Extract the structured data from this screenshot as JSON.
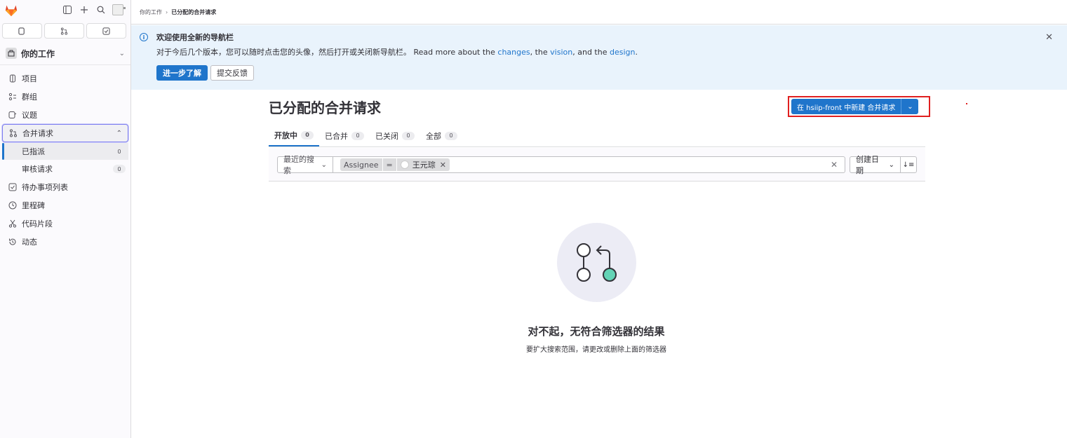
{
  "sidebar": {
    "section_title": "你的工作",
    "nav": [
      {
        "label": "项目",
        "icon": "project-icon"
      },
      {
        "label": "群组",
        "icon": "group-icon"
      },
      {
        "label": "议题",
        "icon": "issues-icon"
      },
      {
        "label": "合并请求",
        "icon": "merge-request-icon"
      }
    ],
    "sub_items": [
      {
        "label": "已指派",
        "count": "0"
      },
      {
        "label": "审核请求",
        "count": "0"
      }
    ],
    "nav2": [
      {
        "label": "待办事项列表",
        "icon": "todo-icon"
      },
      {
        "label": "里程碑",
        "icon": "milestone-icon"
      },
      {
        "label": "代码片段",
        "icon": "snippet-icon"
      },
      {
        "label": "动态",
        "icon": "activity-icon"
      }
    ]
  },
  "breadcrumb": {
    "parent": "你的工作",
    "current": "已分配的合并请求"
  },
  "banner": {
    "title": "欢迎使用全新的导航栏",
    "body_prefix": "对于今后几个版本，您可以随时点击您的头像，然后打开或关闭新导航栏。 Read more about the ",
    "link_changes": "changes",
    "sep1": ", the ",
    "link_vision": "vision",
    "sep2": ", and the ",
    "link_design": "design",
    "suffix": ".",
    "primary_button": "进一步了解",
    "secondary_button": "提交反馈"
  },
  "page": {
    "title": "已分配的合并请求",
    "new_button": "在 hsiip-front 中新建 合并请求"
  },
  "tabs": [
    {
      "label": "开放中",
      "count": "0",
      "active": true
    },
    {
      "label": "已合并",
      "count": "0"
    },
    {
      "label": "已关闭",
      "count": "0"
    },
    {
      "label": "全部",
      "count": "0"
    }
  ],
  "filter": {
    "recent_label": "最近的搜索",
    "token_key": "Assignee",
    "token_op": "=",
    "token_value": "王元琮",
    "sort_label": "创建日期",
    "sort_dir_label": "↓≡"
  },
  "empty": {
    "title": "对不起，无符合筛选器的结果",
    "description": "要扩大搜索范围，请更改或删除上面的筛选器"
  },
  "colors": {
    "accent": "#1f75cb",
    "highlight_box": "#e02020",
    "illustration_green": "#63d4b6"
  }
}
